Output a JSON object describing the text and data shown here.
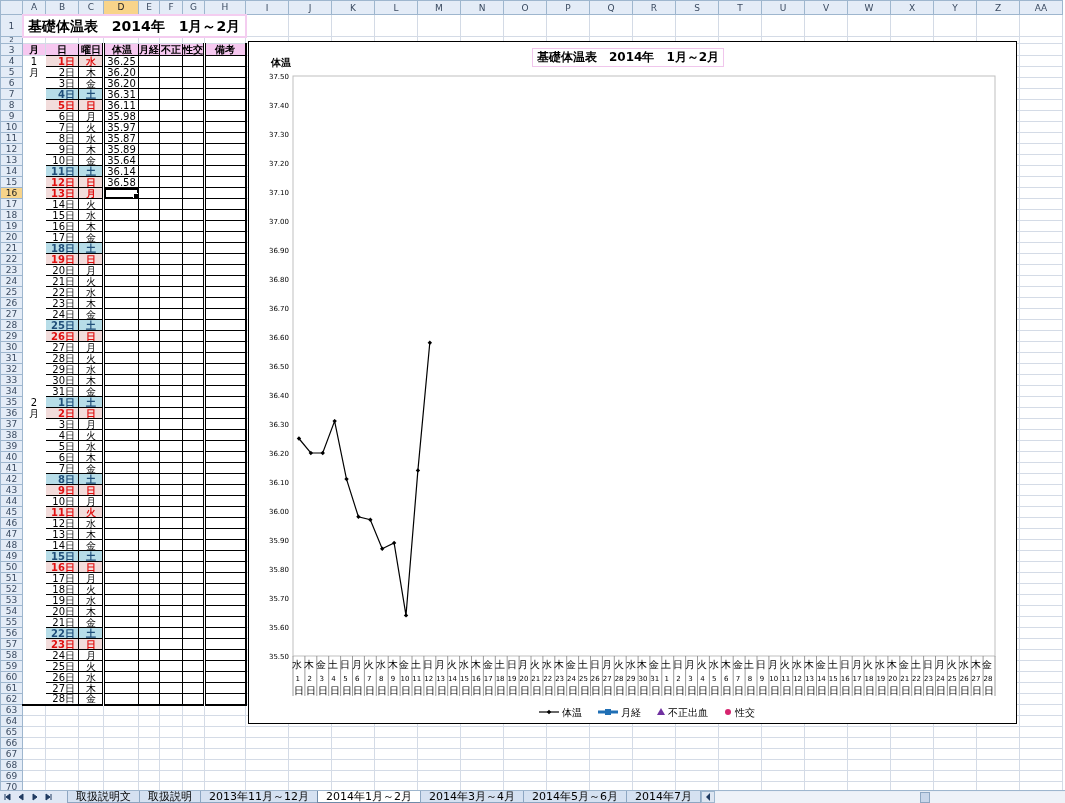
{
  "columns": [
    {
      "label": "A",
      "selected": false
    },
    {
      "label": "B",
      "selected": false
    },
    {
      "label": "C",
      "selected": false
    },
    {
      "label": "D",
      "selected": true
    },
    {
      "label": "E",
      "selected": false
    },
    {
      "label": "F",
      "selected": false
    },
    {
      "label": "G",
      "selected": false
    },
    {
      "label": "H",
      "selected": false
    },
    {
      "label": "I",
      "selected": false
    },
    {
      "label": "J",
      "selected": false
    },
    {
      "label": "K",
      "selected": false
    },
    {
      "label": "L",
      "selected": false
    },
    {
      "label": "M",
      "selected": false
    },
    {
      "label": "N",
      "selected": false
    },
    {
      "label": "O",
      "selected": false
    },
    {
      "label": "P",
      "selected": false
    },
    {
      "label": "Q",
      "selected": false
    },
    {
      "label": "R",
      "selected": false
    },
    {
      "label": "S",
      "selected": false
    },
    {
      "label": "T",
      "selected": false
    },
    {
      "label": "U",
      "selected": false
    },
    {
      "label": "V",
      "selected": false
    },
    {
      "label": "W",
      "selected": false
    },
    {
      "label": "X",
      "selected": false
    },
    {
      "label": "Y",
      "selected": false
    },
    {
      "label": "Z",
      "selected": false
    },
    {
      "label": "AA",
      "selected": false
    }
  ],
  "rows": [
    {
      "label": "1",
      "selected": false
    },
    {
      "label": "2",
      "selected": false
    },
    {
      "label": "3",
      "selected": false
    },
    {
      "label": "4",
      "selected": false
    },
    {
      "label": "5",
      "selected": false
    },
    {
      "label": "6",
      "selected": false
    },
    {
      "label": "7",
      "selected": false
    },
    {
      "label": "8",
      "selected": false
    },
    {
      "label": "9",
      "selected": false
    },
    {
      "label": "10",
      "selected": false
    },
    {
      "label": "11",
      "selected": false
    },
    {
      "label": "12",
      "selected": false
    },
    {
      "label": "13",
      "selected": false
    },
    {
      "label": "14",
      "selected": false
    },
    {
      "label": "15",
      "selected": false
    },
    {
      "label": "16",
      "selected": true
    },
    {
      "label": "17",
      "selected": false
    },
    {
      "label": "18",
      "selected": false
    },
    {
      "label": "19",
      "selected": false
    },
    {
      "label": "20",
      "selected": false
    },
    {
      "label": "21",
      "selected": false
    },
    {
      "label": "22",
      "selected": false
    },
    {
      "label": "23",
      "selected": false
    },
    {
      "label": "24",
      "selected": false
    },
    {
      "label": "25",
      "selected": false
    },
    {
      "label": "26",
      "selected": false
    },
    {
      "label": "27",
      "selected": false
    },
    {
      "label": "28",
      "selected": false
    },
    {
      "label": "29",
      "selected": false
    },
    {
      "label": "30",
      "selected": false
    },
    {
      "label": "31",
      "selected": false
    },
    {
      "label": "32",
      "selected": false
    },
    {
      "label": "33",
      "selected": false
    },
    {
      "label": "34",
      "selected": false
    },
    {
      "label": "35",
      "selected": false
    },
    {
      "label": "36",
      "selected": false
    },
    {
      "label": "37",
      "selected": false
    },
    {
      "label": "38",
      "selected": false
    },
    {
      "label": "39",
      "selected": false
    },
    {
      "label": "40",
      "selected": false
    },
    {
      "label": "41",
      "selected": false
    },
    {
      "label": "42",
      "selected": false
    },
    {
      "label": "43",
      "selected": false
    },
    {
      "label": "44",
      "selected": false
    },
    {
      "label": "45",
      "selected": false
    },
    {
      "label": "46",
      "selected": false
    },
    {
      "label": "47",
      "selected": false
    },
    {
      "label": "48",
      "selected": false
    },
    {
      "label": "49",
      "selected": false
    },
    {
      "label": "50",
      "selected": false
    },
    {
      "label": "51",
      "selected": false
    },
    {
      "label": "52",
      "selected": false
    },
    {
      "label": "53",
      "selected": false
    },
    {
      "label": "54",
      "selected": false
    },
    {
      "label": "55",
      "selected": false
    },
    {
      "label": "56",
      "selected": false
    },
    {
      "label": "57",
      "selected": false
    },
    {
      "label": "58",
      "selected": false
    },
    {
      "label": "59",
      "selected": false
    },
    {
      "label": "60",
      "selected": false
    },
    {
      "label": "61",
      "selected": false
    },
    {
      "label": "62",
      "selected": false
    },
    {
      "label": "63",
      "selected": false
    },
    {
      "label": "64",
      "selected": false
    },
    {
      "label": "65",
      "selected": false
    },
    {
      "label": "66",
      "selected": false
    },
    {
      "label": "67",
      "selected": false
    },
    {
      "label": "68",
      "selected": false
    },
    {
      "label": "69",
      "selected": false
    },
    {
      "label": "70",
      "selected": false
    }
  ],
  "sheet": {
    "title": "基礎体温表　2014年　1月～2月",
    "headers": [
      "月",
      "日",
      "曜日",
      "体温",
      "月経",
      "不正",
      "性交",
      "備考"
    ],
    "days": [
      {
        "month": "1",
        "date": "1日",
        "weekday": "水",
        "kind": "holiday",
        "temp": "36.25",
        "selected": false
      },
      {
        "month": "月",
        "date": "2日",
        "weekday": "木",
        "kind": "weekday",
        "temp": "36.20",
        "selected": false
      },
      {
        "date": "3日",
        "weekday": "金",
        "kind": "weekday",
        "temp": "36.20",
        "selected": false
      },
      {
        "date": "4日",
        "weekday": "土",
        "kind": "saturday",
        "temp": "36.31",
        "selected": false
      },
      {
        "date": "5日",
        "weekday": "日",
        "kind": "holiday",
        "temp": "36.11",
        "selected": false
      },
      {
        "date": "6日",
        "weekday": "月",
        "kind": "weekday",
        "temp": "35.98",
        "selected": false
      },
      {
        "date": "7日",
        "weekday": "火",
        "kind": "weekday",
        "temp": "35.97",
        "selected": false
      },
      {
        "date": "8日",
        "weekday": "水",
        "kind": "weekday",
        "temp": "35.87",
        "selected": false
      },
      {
        "date": "9日",
        "weekday": "木",
        "kind": "weekday",
        "temp": "35.89",
        "selected": false
      },
      {
        "date": "10日",
        "weekday": "金",
        "kind": "weekday",
        "temp": "35.64",
        "selected": false
      },
      {
        "date": "11日",
        "weekday": "土",
        "kind": "saturday",
        "temp": "36.14",
        "selected": false
      },
      {
        "date": "12日",
        "weekday": "日",
        "kind": "holiday",
        "temp": "36.58",
        "selected": false
      },
      {
        "date": "13日",
        "weekday": "月",
        "kind": "holiday",
        "selected": true
      },
      {
        "date": "14日",
        "weekday": "火",
        "kind": "weekday",
        "selected": false
      },
      {
        "date": "15日",
        "weekday": "水",
        "kind": "weekday",
        "selected": false
      },
      {
        "date": "16日",
        "weekday": "木",
        "kind": "weekday",
        "selected": false
      },
      {
        "date": "17日",
        "weekday": "金",
        "kind": "weekday",
        "selected": false
      },
      {
        "date": "18日",
        "weekday": "土",
        "kind": "saturday",
        "selected": false
      },
      {
        "date": "19日",
        "weekday": "日",
        "kind": "holiday",
        "selected": false
      },
      {
        "date": "20日",
        "weekday": "月",
        "kind": "weekday",
        "selected": false
      },
      {
        "date": "21日",
        "weekday": "火",
        "kind": "weekday",
        "selected": false
      },
      {
        "date": "22日",
        "weekday": "水",
        "kind": "weekday",
        "selected": false
      },
      {
        "date": "23日",
        "weekday": "木",
        "kind": "weekday",
        "selected": false
      },
      {
        "date": "24日",
        "weekday": "金",
        "kind": "weekday",
        "selected": false
      },
      {
        "date": "25日",
        "weekday": "土",
        "kind": "saturday",
        "selected": false
      },
      {
        "date": "26日",
        "weekday": "日",
        "kind": "holiday",
        "selected": false
      },
      {
        "date": "27日",
        "weekday": "月",
        "kind": "weekday",
        "selected": false
      },
      {
        "date": "28日",
        "weekday": "火",
        "kind": "weekday",
        "selected": false
      },
      {
        "date": "29日",
        "weekday": "水",
        "kind": "weekday",
        "selected": false
      },
      {
        "date": "30日",
        "weekday": "木",
        "kind": "weekday",
        "selected": false
      },
      {
        "date": "31日",
        "weekday": "金",
        "kind": "weekday",
        "selected": false
      },
      {
        "month": "2",
        "date": "1日",
        "weekday": "土",
        "kind": "saturday",
        "selected": false
      },
      {
        "month": "月",
        "date": "2日",
        "weekday": "日",
        "kind": "holiday",
        "selected": false
      },
      {
        "date": "3日",
        "weekday": "月",
        "kind": "weekday",
        "selected": false
      },
      {
        "date": "4日",
        "weekday": "火",
        "kind": "weekday",
        "selected": false
      },
      {
        "date": "5日",
        "weekday": "水",
        "kind": "weekday",
        "selected": false
      },
      {
        "date": "6日",
        "weekday": "木",
        "kind": "weekday",
        "selected": false
      },
      {
        "date": "7日",
        "weekday": "金",
        "kind": "weekday",
        "selected": false
      },
      {
        "date": "8日",
        "weekday": "土",
        "kind": "saturday",
        "selected": false
      },
      {
        "date": "9日",
        "weekday": "日",
        "kind": "holiday",
        "selected": false
      },
      {
        "date": "10日",
        "weekday": "月",
        "kind": "weekday",
        "selected": false
      },
      {
        "date": "11日",
        "weekday": "火",
        "kind": "holiday",
        "selected": false
      },
      {
        "date": "12日",
        "weekday": "水",
        "kind": "weekday",
        "selected": false
      },
      {
        "date": "13日",
        "weekday": "木",
        "kind": "weekday",
        "selected": false
      },
      {
        "date": "14日",
        "weekday": "金",
        "kind": "weekday",
        "selected": false
      },
      {
        "date": "15日",
        "weekday": "土",
        "kind": "saturday",
        "selected": false
      },
      {
        "date": "16日",
        "weekday": "日",
        "kind": "holiday",
        "selected": false
      },
      {
        "date": "17日",
        "weekday": "月",
        "kind": "weekday",
        "selected": false
      },
      {
        "date": "18日",
        "weekday": "火",
        "kind": "weekday",
        "selected": false
      },
      {
        "date": "19日",
        "weekday": "水",
        "kind": "weekday",
        "selected": false
      },
      {
        "date": "20日",
        "weekday": "木",
        "kind": "weekday",
        "selected": false
      },
      {
        "date": "21日",
        "weekday": "金",
        "kind": "weekday",
        "selected": false
      },
      {
        "date": "22日",
        "weekday": "土",
        "kind": "saturday",
        "selected": false
      },
      {
        "date": "23日",
        "weekday": "日",
        "kind": "holiday",
        "selected": false
      },
      {
        "date": "24日",
        "weekday": "月",
        "kind": "weekday",
        "selected": false
      },
      {
        "date": "25日",
        "weekday": "火",
        "kind": "weekday",
        "selected": false
      },
      {
        "date": "26日",
        "weekday": "水",
        "kind": "weekday",
        "selected": false
      },
      {
        "date": "27日",
        "weekday": "木",
        "kind": "weekday",
        "selected": false
      },
      {
        "date": "28日",
        "weekday": "金",
        "kind": "weekday",
        "selected": false
      }
    ]
  },
  "chart": {
    "chart_data": {
      "type": "line",
      "title": "基礎体温表　2014年　1月～2月",
      "ylabel": "体温",
      "categories": [
        "水 1 日",
        "木 2 日",
        "金 3 日",
        "土 4 日",
        "日 5 日",
        "月 6 日",
        "火 7 日",
        "水 8 日",
        "木 9 日",
        "金 10 日",
        "土 11 日",
        "日 12 日",
        "月 13 日",
        "火 14 日",
        "水 15 日",
        "木 16 日",
        "金 17 日",
        "土 18 日",
        "日 19 日",
        "月 20 日",
        "火 21 日",
        "水 22 日",
        "木 23 日",
        "金 24 日",
        "土 25 日",
        "日 26 日",
        "月 27 日",
        "火 28 日",
        "水 29 日",
        "木 30 日",
        "金 31 日",
        "土 1 日",
        "日 2 日",
        "月 3 日",
        "火 4 日",
        "水 5 日",
        "木 6 日",
        "金 7 日",
        "土 8 日",
        "日 9 日",
        "月 10 日",
        "火 11 日",
        "水 12 日",
        "木 13 日",
        "金 14 日",
        "土 15 日",
        "日 16 日",
        "月 17 日",
        "火 18 日",
        "水 19 日",
        "木 20 日",
        "金 21 日",
        "土 22 日",
        "日 23 日",
        "月 24 日",
        "火 25 日",
        "水 26 日",
        "木 27 日",
        "金 28 日"
      ],
      "ylim": [
        35.5,
        37.5
      ],
      "yticks": [
        {
          "value": 35.5,
          "label": "35.50"
        },
        {
          "value": 35.6,
          "label": "35.60"
        },
        {
          "value": 35.7,
          "label": "35.70"
        },
        {
          "value": 35.8,
          "label": "35.80"
        },
        {
          "value": 35.9,
          "label": "35.90"
        },
        {
          "value": 36.0,
          "label": "36.00"
        },
        {
          "value": 36.1,
          "label": "36.10"
        },
        {
          "value": 36.2,
          "label": "36.20"
        },
        {
          "value": 36.3,
          "label": "36.30"
        },
        {
          "value": 36.4,
          "label": "36.40"
        },
        {
          "value": 36.5,
          "label": "36.50"
        },
        {
          "value": 36.6,
          "label": "36.60"
        },
        {
          "value": 36.7,
          "label": "36.70"
        },
        {
          "value": 36.8,
          "label": "36.80"
        },
        {
          "value": 36.9,
          "label": "36.90"
        },
        {
          "value": 37.0,
          "label": "37.00"
        },
        {
          "value": 37.1,
          "label": "37.10"
        },
        {
          "value": 37.2,
          "label": "37.20"
        },
        {
          "value": 37.3,
          "label": "37.30"
        },
        {
          "value": 37.4,
          "label": "37.40"
        },
        {
          "value": 37.5,
          "label": "37.50"
        }
      ],
      "series": [
        {
          "name": "体温",
          "color": "#000000",
          "marker": "diamond",
          "values": [
            36.25,
            36.2,
            36.2,
            36.31,
            36.11,
            35.98,
            35.97,
            35.87,
            35.89,
            35.64,
            36.14,
            36.58,
            null,
            null,
            null,
            null,
            null,
            null,
            null,
            null,
            null,
            null,
            null,
            null,
            null,
            null,
            null,
            null,
            null,
            null,
            null,
            null,
            null,
            null,
            null,
            null,
            null,
            null,
            null,
            null,
            null,
            null,
            null,
            null,
            null,
            null,
            null,
            null,
            null,
            null,
            null,
            null,
            null,
            null,
            null,
            null,
            null,
            null,
            null
          ]
        },
        {
          "name": "月経",
          "color": "#1f6fb5",
          "marker": "square",
          "values": [
            null,
            null,
            null,
            null,
            null,
            null,
            null,
            null,
            null,
            null,
            null,
            null,
            null,
            null,
            null,
            null,
            null,
            null,
            null,
            null,
            null,
            null,
            null,
            null,
            null,
            null,
            null,
            null,
            null,
            null,
            null,
            null,
            null,
            null,
            null,
            null,
            null,
            null,
            null,
            null,
            null,
            null,
            null,
            null,
            null,
            null,
            null,
            null,
            null,
            null,
            null,
            null,
            null,
            null,
            null,
            null,
            null,
            null,
            null
          ]
        },
        {
          "name": "不正出血",
          "color": "#7030a0",
          "marker": "triangle",
          "values": [
            null,
            null,
            null,
            null,
            null,
            null,
            null,
            null,
            null,
            null,
            null,
            null,
            null,
            null,
            null,
            null,
            null,
            null,
            null,
            null,
            null,
            null,
            null,
            null,
            null,
            null,
            null,
            null,
            null,
            null,
            null,
            null,
            null,
            null,
            null,
            null,
            null,
            null,
            null,
            null,
            null,
            null,
            null,
            null,
            null,
            null,
            null,
            null,
            null,
            null,
            null,
            null,
            null,
            null,
            null,
            null,
            null,
            null,
            null
          ]
        },
        {
          "name": "性交",
          "color": "#d6246e",
          "marker": "circle",
          "values": [
            null,
            null,
            null,
            null,
            null,
            null,
            null,
            null,
            null,
            null,
            null,
            null,
            null,
            null,
            null,
            null,
            null,
            null,
            null,
            null,
            null,
            null,
            null,
            null,
            null,
            null,
            null,
            null,
            null,
            null,
            null,
            null,
            null,
            null,
            null,
            null,
            null,
            null,
            null,
            null,
            null,
            null,
            null,
            null,
            null,
            null,
            null,
            null,
            null,
            null,
            null,
            null,
            null,
            null,
            null,
            null,
            null,
            null,
            null
          ]
        }
      ]
    }
  },
  "sheet_tabs": [
    {
      "label": "取扱説明文",
      "selected": false
    },
    {
      "label": "取扱説明",
      "selected": false
    },
    {
      "label": "2013年11月～12月",
      "selected": false
    },
    {
      "label": "2014年1月～2月",
      "selected": true
    },
    {
      "label": "2014年3月～4月",
      "selected": false
    },
    {
      "label": "2014年5月～6月",
      "selected": false
    },
    {
      "label": "2014年7月",
      "selected": false
    }
  ]
}
